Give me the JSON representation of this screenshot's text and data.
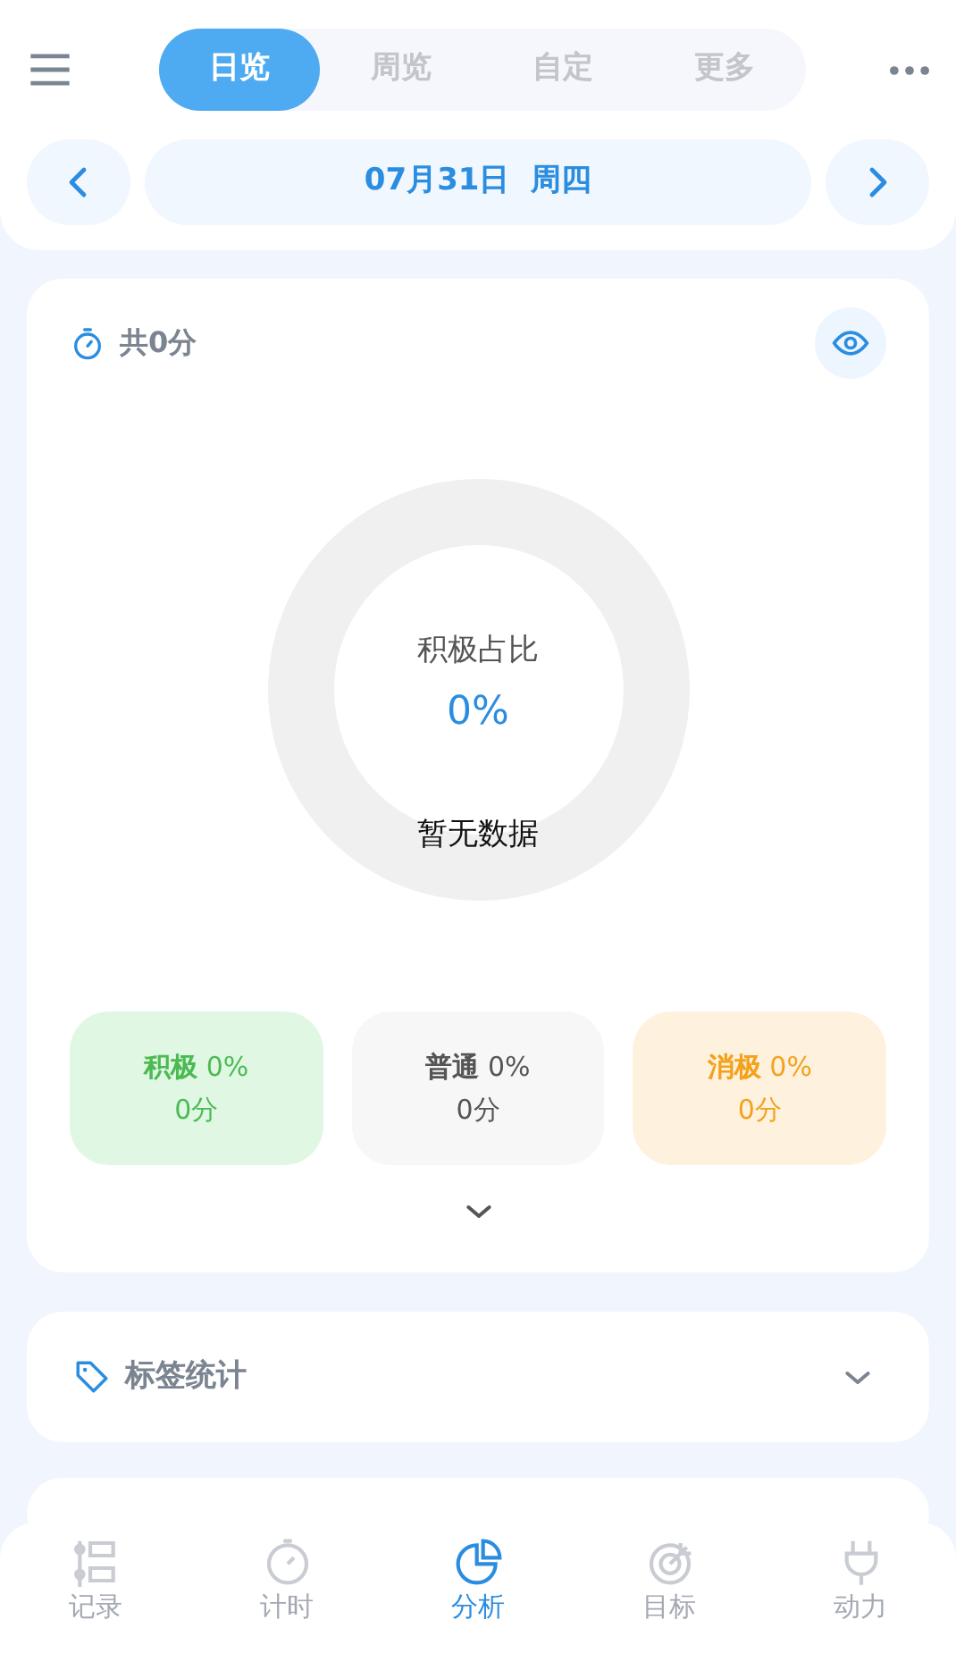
{
  "tabs": [
    {
      "label": "日览",
      "selected": true
    },
    {
      "label": "周览",
      "selected": false
    },
    {
      "label": "自定",
      "selected": false
    },
    {
      "label": "更多",
      "selected": false
    }
  ],
  "date": "07月31日  周四",
  "summary": {
    "total": "共0分",
    "donut": {
      "label": "积极占比",
      "value": "0%",
      "empty_text": "暂无数据"
    },
    "categories": [
      {
        "kind": "positive",
        "name": "积极",
        "percent": "0%",
        "minutes": "0分"
      },
      {
        "kind": "neutral",
        "name": "普通",
        "percent": "0%",
        "minutes": "0分"
      },
      {
        "kind": "negative",
        "name": "消极",
        "percent": "0%",
        "minutes": "0分"
      }
    ]
  },
  "tag_stats": {
    "title": "标签统计",
    "expanded": false
  },
  "bottom_nav": [
    {
      "label": "记录",
      "selected": false
    },
    {
      "label": "计时",
      "selected": false
    },
    {
      "label": "分析",
      "selected": true
    },
    {
      "label": "目标",
      "selected": false
    },
    {
      "label": "动力",
      "selected": false
    }
  ]
}
